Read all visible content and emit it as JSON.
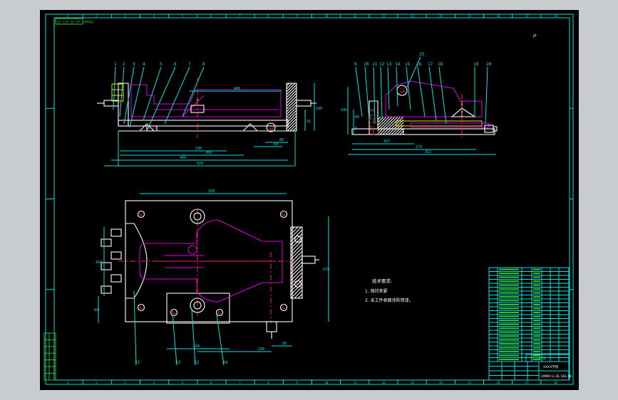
{
  "drawing": {
    "header_code": "BI LZ2 02 BT CHM502",
    "corner_mark": "JP",
    "grid_numbers_top": [
      "1",
      "2",
      "3",
      "4",
      "5",
      "6",
      "7",
      "8",
      "9",
      "10",
      "11",
      "12",
      "13",
      "14",
      "15",
      "16",
      "17",
      "18"
    ],
    "views": {
      "front": {
        "balloons": [
          "1",
          "2",
          "3",
          "4",
          "5",
          "6",
          "7",
          "8"
        ],
        "dims": {
          "top": "460",
          "d1": "236",
          "d2": "260",
          "d3": "404",
          "d4": "429",
          "r1": "60",
          "r2": "66",
          "v1": "130",
          "v2": "31"
        }
      },
      "side": {
        "balloons": [
          "9",
          "10",
          "11",
          "12",
          "13",
          "14",
          "15",
          "16",
          "17",
          "18",
          "19",
          "20"
        ],
        "balloon_top": "25",
        "dims": {
          "b1": "187",
          "b2": "273",
          "b3": "313",
          "l1": "195",
          "l2": "60",
          "l3": "6"
        }
      },
      "top": {
        "dims": {
          "top": "320",
          "left1": "160",
          "left2": "63",
          "right1": "273",
          "b1": "L60",
          "b2": "236",
          "b3": "56"
        },
        "balloons": [
          "21",
          "23",
          "22",
          "24"
        ]
      }
    },
    "tech_notes": {
      "title": "技术要求:",
      "items": [
        "1.   保持夹紧",
        "2.   未工件表面涂防锈漆。"
      ]
    },
    "title_block": {
      "label_box": "尼龙夹具",
      "school": "XXXX学院",
      "drawing_no": "LMMAI LL DL SDL 08"
    }
  }
}
